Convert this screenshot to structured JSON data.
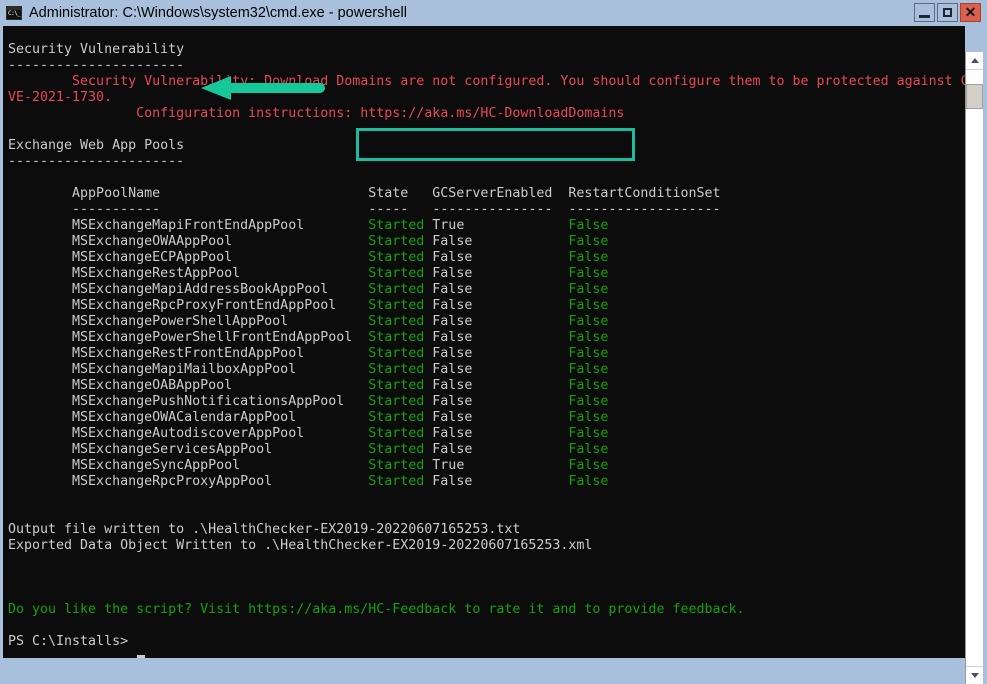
{
  "window": {
    "title": "Administrator: C:\\Windows\\system32\\cmd.exe - powershell",
    "icon": "console-icon",
    "controls": {
      "minimize": "–",
      "maximize": "□",
      "close": "✕"
    }
  },
  "colors": {
    "titlebar_bg": "#a8c0dc",
    "console_bg": "#0c0c0c",
    "text_white": "#cccccc",
    "text_red": "#e74856",
    "text_green": "#13a10e",
    "annotation_teal": "#1abc9c",
    "close_button": "#d9604c"
  },
  "console": {
    "security_section": {
      "heading": "Security Vulnerability",
      "underline": "----------------------",
      "message_line1": "        Security Vulnerability: Download Domains are not configured. You should configure them to be protected against C",
      "message_line2": "VE-2021-1730.",
      "config_label": "                Configuration instructions: ",
      "config_url": "https://aka.ms/HC-DownloadDomains"
    },
    "apppools_section": {
      "heading": "Exchange Web App Pools",
      "underline": "----------------------",
      "columns": [
        "AppPoolName",
        "State",
        "GCServerEnabled",
        "RestartConditionSet"
      ],
      "column_underlines": [
        "-----------",
        "-----",
        "---------------",
        "-------------------"
      ],
      "rows": [
        {
          "name": "MSExchangeMapiFrontEndAppPool",
          "state": "Started",
          "gc": "True",
          "restart": "False"
        },
        {
          "name": "MSExchangeOWAAppPool",
          "state": "Started",
          "gc": "False",
          "restart": "False"
        },
        {
          "name": "MSExchangeECPAppPool",
          "state": "Started",
          "gc": "False",
          "restart": "False"
        },
        {
          "name": "MSExchangeRestAppPool",
          "state": "Started",
          "gc": "False",
          "restart": "False"
        },
        {
          "name": "MSExchangeMapiAddressBookAppPool",
          "state": "Started",
          "gc": "False",
          "restart": "False"
        },
        {
          "name": "MSExchangeRpcProxyFrontEndAppPool",
          "state": "Started",
          "gc": "False",
          "restart": "False"
        },
        {
          "name": "MSExchangePowerShellAppPool",
          "state": "Started",
          "gc": "False",
          "restart": "False"
        },
        {
          "name": "MSExchangePowerShellFrontEndAppPool",
          "state": "Started",
          "gc": "False",
          "restart": "False"
        },
        {
          "name": "MSExchangeRestFrontEndAppPool",
          "state": "Started",
          "gc": "False",
          "restart": "False"
        },
        {
          "name": "MSExchangeMapiMailboxAppPool",
          "state": "Started",
          "gc": "False",
          "restart": "False"
        },
        {
          "name": "MSExchangeOABAppPool",
          "state": "Started",
          "gc": "False",
          "restart": "False"
        },
        {
          "name": "MSExchangePushNotificationsAppPool",
          "state": "Started",
          "gc": "False",
          "restart": "False"
        },
        {
          "name": "MSExchangeOWACalendarAppPool",
          "state": "Started",
          "gc": "False",
          "restart": "False"
        },
        {
          "name": "MSExchangeAutodiscoverAppPool",
          "state": "Started",
          "gc": "False",
          "restart": "False"
        },
        {
          "name": "MSExchangeServicesAppPool",
          "state": "Started",
          "gc": "False",
          "restart": "False"
        },
        {
          "name": "MSExchangeSyncAppPool",
          "state": "Started",
          "gc": "True",
          "restart": "False"
        },
        {
          "name": "MSExchangeRpcProxyAppPool",
          "state": "Started",
          "gc": "False",
          "restart": "False"
        }
      ]
    },
    "output_lines": [
      "Output file written to .\\HealthChecker-EX2019-20220607165253.txt",
      "Exported Data Object Written to .\\HealthChecker-EX2019-20220607165253.xml"
    ],
    "feedback_line": "Do you like the script? Visit https://aka.ms/HC-Feedback to rate it and to provide feedback.",
    "prompt": "PS C:\\Installs> "
  },
  "scrollbar": {
    "up_arrow": "scroll-up",
    "down_arrow": "scroll-down"
  }
}
